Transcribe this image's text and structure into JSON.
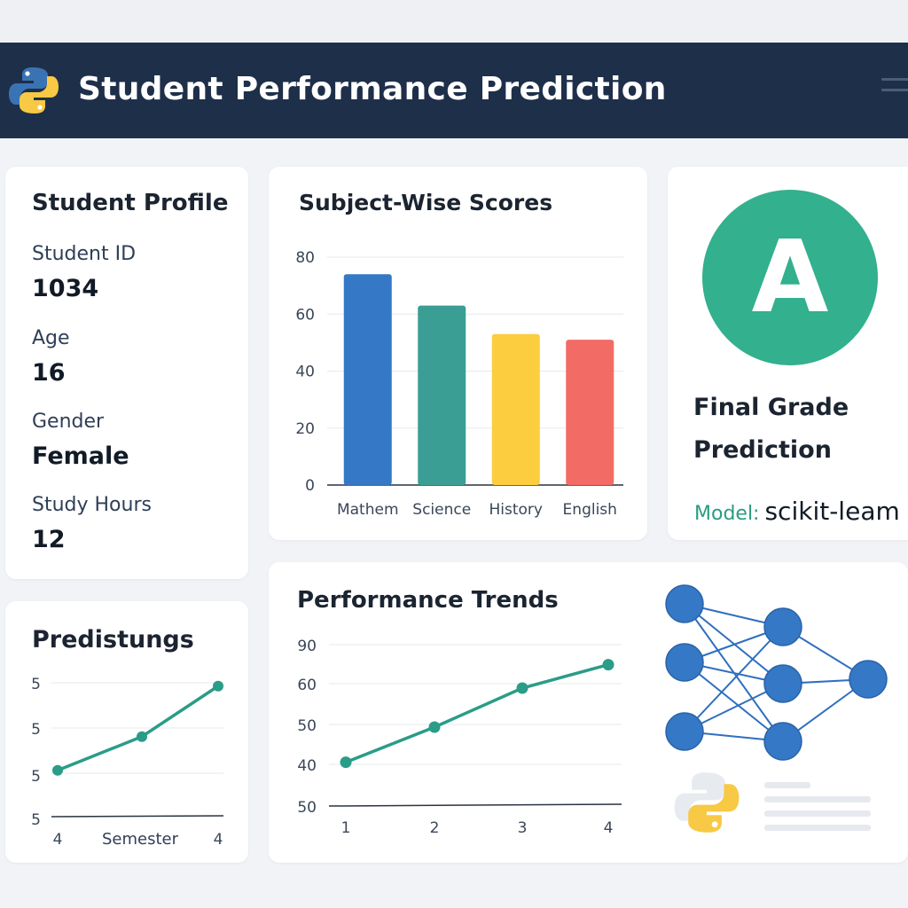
{
  "header": {
    "title": "Student Performance Prediction",
    "logo_icon": "python-logo-icon",
    "menu_icon": "hamburger-menu-icon"
  },
  "profile": {
    "title": "Student Profile",
    "fields": [
      {
        "label": "Student ID",
        "value": "1034"
      },
      {
        "label": "Age",
        "value": "16"
      },
      {
        "label": "Gender",
        "value": "Female"
      },
      {
        "label": "Study Hours",
        "value": "12"
      }
    ]
  },
  "scores": {
    "title": "Subject-Wise Scores"
  },
  "prediction": {
    "grade": "A",
    "label_line1": "Final Grade",
    "label_line2": "Prediction",
    "model_label": "Model:",
    "model_value": "scikit-leam"
  },
  "predistungs": {
    "title": "Predistungs"
  },
  "trends": {
    "title": "Performance Trends"
  },
  "colors": {
    "header_bg": "#1e2f4a",
    "accent_green": "#33b08d",
    "line_teal": "#2a9c88",
    "node_blue": "#3478c6",
    "bar_blue": "#3478c6",
    "bar_teal": "#3a9e94",
    "bar_yellow": "#fbcd3f",
    "bar_red": "#f26b64"
  },
  "chart_data": [
    {
      "type": "bar",
      "title": "Subject-Wise Scores",
      "categories": [
        "Mathem",
        "Science",
        "History",
        "English"
      ],
      "values": [
        74,
        63,
        53,
        51
      ],
      "colors": [
        "#3478c6",
        "#3a9e94",
        "#fbcd3f",
        "#f26b64"
      ],
      "yticks": [
        "0",
        "20",
        "40",
        "60",
        "80"
      ],
      "ylim": [
        0,
        80
      ],
      "grid": true
    },
    {
      "type": "line",
      "title": "Predistungs",
      "xlabel": "Semester",
      "xticks": [
        "4",
        "4"
      ],
      "yticks": [
        "5",
        "5",
        "5",
        "5"
      ],
      "y": [
        1.1,
        1.9,
        3.1
      ],
      "ylim": [
        0,
        4
      ],
      "grid": true
    },
    {
      "type": "line",
      "title": "Performance Trends",
      "x": [
        1,
        2,
        3,
        4
      ],
      "y": [
        41,
        50,
        60,
        66
      ],
      "xticks": [
        "1",
        "2",
        "3",
        "4"
      ],
      "yticks": [
        "50",
        "40",
        "50",
        "60",
        "90"
      ],
      "ylim": [
        30,
        80
      ],
      "grid": true
    }
  ]
}
